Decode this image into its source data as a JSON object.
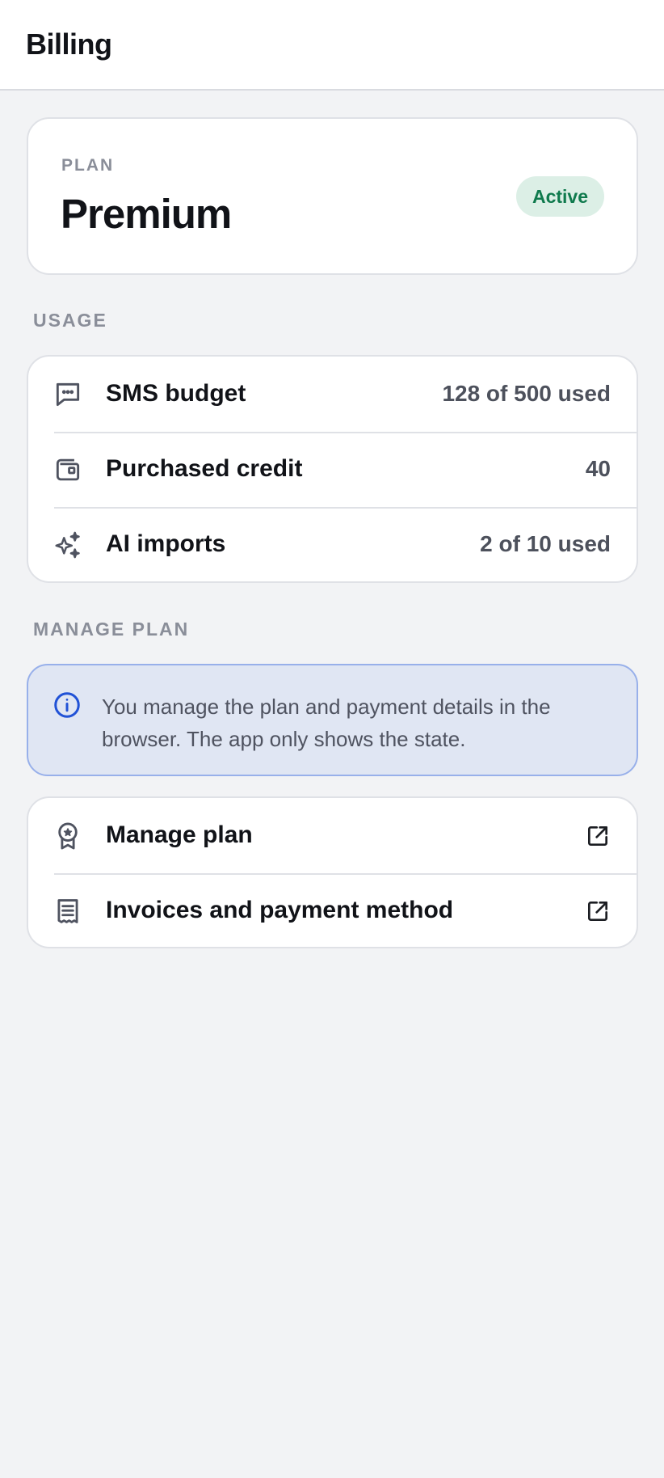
{
  "header": {
    "title": "Billing"
  },
  "plan": {
    "label": "PLAN",
    "name": "Premium",
    "status": "Active"
  },
  "usage": {
    "section_label": "USAGE",
    "rows": [
      {
        "icon": "message-icon",
        "label": "SMS budget",
        "value": "128 of 500 used"
      },
      {
        "icon": "wallet-icon",
        "label": "Purchased credit",
        "value": "40"
      },
      {
        "icon": "sparkles-icon",
        "label": "AI imports",
        "value": "2 of 10 used"
      }
    ]
  },
  "manage": {
    "section_label": "MANAGE PLAN",
    "info_text": "You manage the plan and payment details in the browser. The app only shows the state.",
    "links": [
      {
        "icon": "award-icon",
        "label": "Manage plan",
        "action_icon": "external-link-icon"
      },
      {
        "icon": "receipt-icon",
        "label": "Invoices and payment method",
        "action_icon": "external-link-icon"
      }
    ]
  },
  "colors": {
    "background": "#f2f3f5",
    "status_active_bg": "#dcefe6",
    "status_active_text": "#0f7a4d",
    "info_bg": "#e0e6f3",
    "info_border": "#98b0ea",
    "info_icon": "#2152d6"
  }
}
